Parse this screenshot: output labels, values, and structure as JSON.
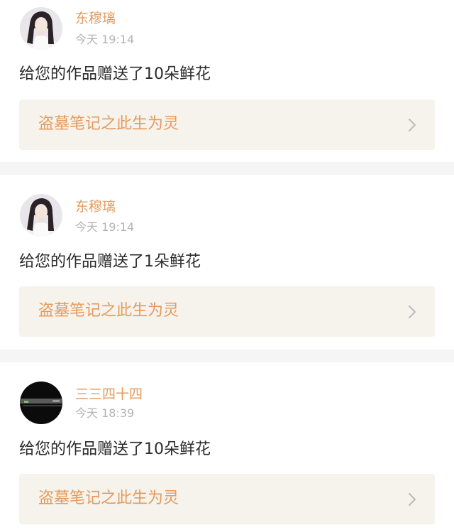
{
  "notifications": [
    {
      "username": "东穆璃",
      "time": "今天 19:14",
      "message": "给您的作品赠送了10朵鲜花",
      "work_title": "盗墓笔记之此生为灵",
      "avatar_icon": "portrait-avatar-icon"
    },
    {
      "username": "东穆璃",
      "time": "今天 19:14",
      "message": "给您的作品赠送了1朵鲜花",
      "work_title": "盗墓笔记之此生为灵",
      "avatar_icon": "portrait-avatar-icon"
    },
    {
      "username": "三三四十四",
      "time": "今天 18:39",
      "message": "给您的作品赠送了10朵鲜花",
      "work_title": "盗墓笔记之此生为灵",
      "avatar_icon": "dark-avatar-icon"
    }
  ],
  "colors": {
    "accent": "#e59a5e",
    "timestamp": "#b3b3b3",
    "message_text": "#2b2b2b",
    "link_background": "#f5f3ec",
    "divider": "#f5f5f5"
  }
}
